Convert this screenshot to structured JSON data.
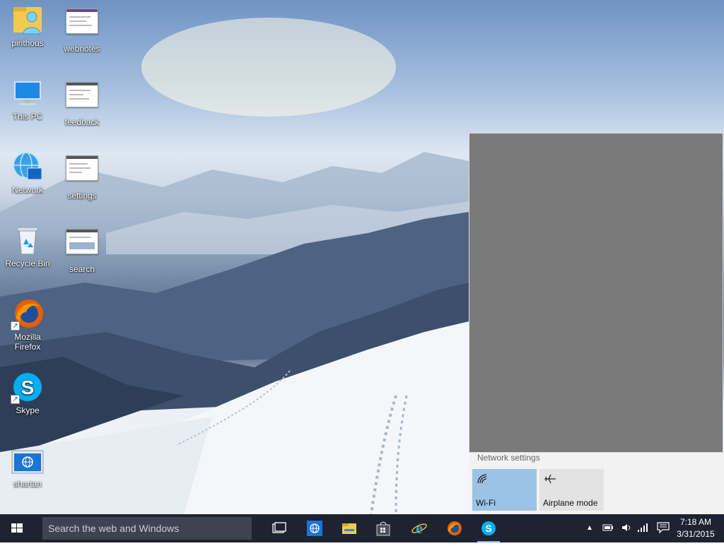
{
  "desktop": {
    "icons": [
      {
        "label": "pirithous",
        "icon": "user-folder-icon"
      },
      {
        "label": "webnotes",
        "icon": "document-thumbnail-icon"
      },
      {
        "label": "This PC",
        "icon": "computer-monitor-icon"
      },
      {
        "label": "feedback",
        "icon": "document-thumbnail-icon"
      },
      {
        "label": "Network",
        "icon": "network-globe-icon"
      },
      {
        "label": "settings",
        "icon": "document-thumbnail-icon"
      },
      {
        "label": "Recycle Bin",
        "icon": "recycle-bin-icon"
      },
      {
        "label": "search",
        "icon": "document-thumbnail-icon"
      },
      {
        "label": "Mozilla Firefox",
        "label_line1": "Mozilla",
        "label_line2": "Firefox",
        "icon": "firefox-icon"
      },
      {
        "label": "Skype",
        "icon": "skype-icon"
      },
      {
        "label": "shartan",
        "icon": "globe-window-icon"
      }
    ]
  },
  "network_flyout": {
    "settings_link": "Network settings",
    "tiles": [
      {
        "label": "Wi-Fi",
        "icon": "wifi-icon",
        "active": true
      },
      {
        "label": "Airplane mode",
        "icon": "airplane-icon",
        "active": false
      }
    ]
  },
  "taskbar": {
    "search_placeholder": "Search the web and Windows",
    "apps": [
      "task-view-icon",
      "ie-app-icon",
      "file-explorer-icon",
      "store-icon",
      "internet-explorer-icon",
      "firefox-icon",
      "skype-icon"
    ],
    "clock": {
      "time": "7:18 AM",
      "date": "3/31/2015"
    }
  },
  "colors": {
    "taskbar": "#1d2331",
    "wifi_tile_active": "#9cc3e6",
    "tile_inactive": "#e3e3e3",
    "accent": "#0078d7"
  }
}
